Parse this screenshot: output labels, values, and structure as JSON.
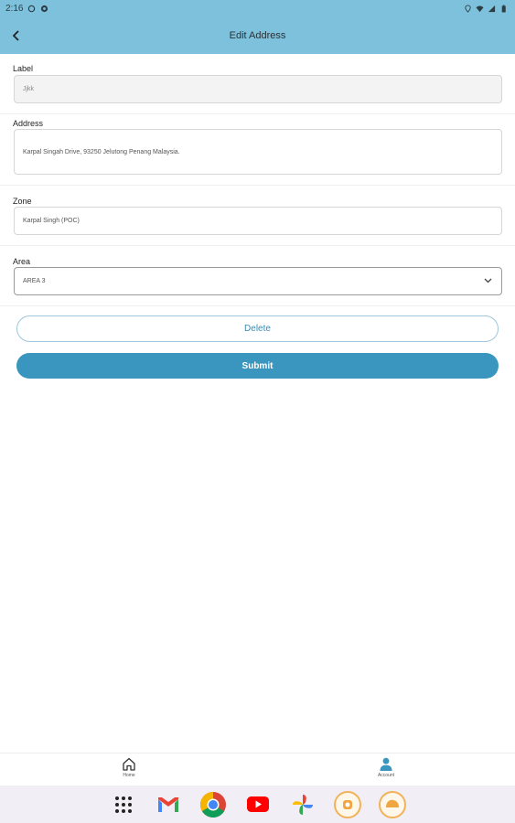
{
  "status_bar": {
    "time": "2:16"
  },
  "app_bar": {
    "title": "Edit Address",
    "back_icon": "arrow-back-icon"
  },
  "form": {
    "label": {
      "label": "Label",
      "value": "Jjkk"
    },
    "address": {
      "label": "Address",
      "value": "Karpal Singah Drive, 93250 Jelutong Penang Malaysia."
    },
    "zone": {
      "label": "Zone",
      "value": "Karpal Singh (POC)"
    },
    "area": {
      "label": "Area",
      "value": "AREA 3"
    }
  },
  "buttons": {
    "delete": "Delete",
    "submit": "Submit"
  },
  "bottom_nav": {
    "home": "Home",
    "account": "Account"
  },
  "colors": {
    "app_bar": "#7ec1dc",
    "accent": "#3a96be",
    "taskbar": "#f1eef6"
  },
  "taskbar_apps": [
    "apps-grid-icon",
    "gmail-icon",
    "chrome-icon",
    "youtube-icon",
    "photos-icon",
    "app-icon-1",
    "app-icon-2"
  ]
}
